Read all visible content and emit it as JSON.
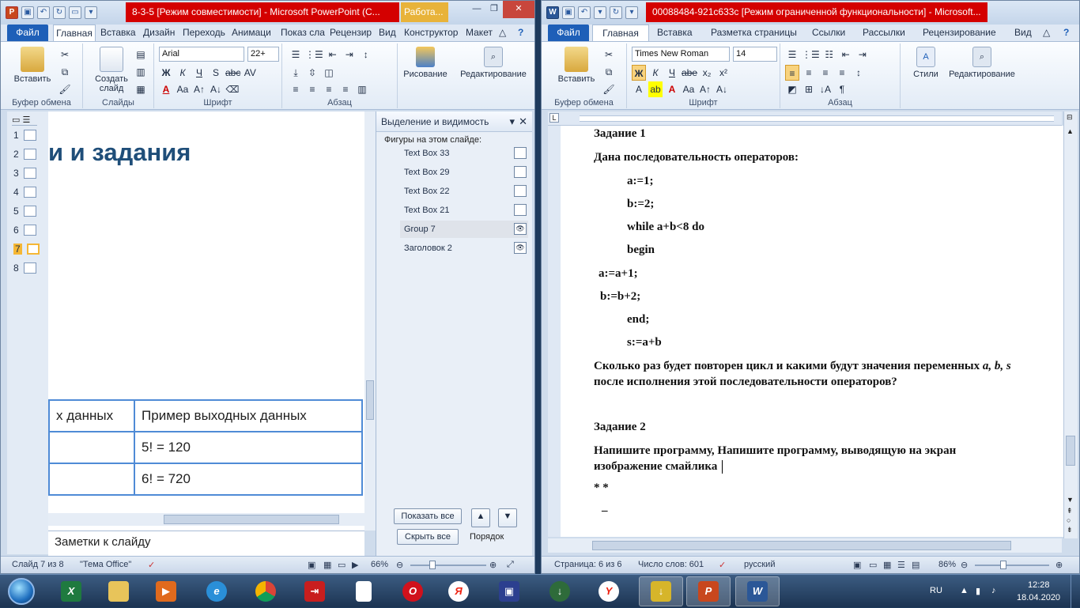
{
  "ppt": {
    "title": "8-3-5 [Режим совместимости] - Microsoft PowerPoint (С...",
    "context_tab": "Работа...",
    "tabs": {
      "file": "Файл",
      "home": "Главная",
      "insert": "Вставка",
      "design": "Дизайн",
      "transitions": "Переходь",
      "animations": "Анимаци",
      "slideshow": "Показ сла",
      "review": "Рецензир",
      "view": "Вид",
      "constructor": "Конструктор",
      "layout": "Макет"
    },
    "ribbon": {
      "paste": "Вставить",
      "new_slide": "Создать слайд",
      "font_name": "Arial",
      "font_size": "22+",
      "drawing": "Рисование",
      "editing": "Редактирование",
      "groups": {
        "clipboard": "Буфер обмена",
        "slides": "Слайды",
        "font": "Шрифт",
        "paragraph": "Абзац"
      }
    },
    "slides": [
      "1",
      "2",
      "3",
      "4",
      "5",
      "6",
      "7",
      "8"
    ],
    "slide": {
      "heading": "и и задания",
      "table": [
        [
          "х данных",
          "Пример  выходных данных"
        ],
        [
          "",
          "5! = 120"
        ],
        [
          "",
          "6! = 720"
        ]
      ]
    },
    "notes": "Заметки к слайду",
    "selection_pane": {
      "title": "Выделение и видимость",
      "subtitle": "Фигуры на этом слайде:",
      "items": [
        "Text Box 33",
        "Text Box 29",
        "Text Box 22",
        "Text Box 21",
        "Group 7",
        "Заголовок 2"
      ],
      "show_all": "Показать все",
      "hide_all": "Скрыть все",
      "order": "Порядок"
    },
    "status": {
      "slide": "Слайд 7 из 8",
      "theme": "\"Тема Office\"",
      "zoom": "66%"
    }
  },
  "word": {
    "title": "00088484-921c633c [Режим ограниченной функциональности] - Microsoft...",
    "tabs": {
      "file": "Файл",
      "home": "Главная",
      "insert": "Вставка",
      "page_layout": "Разметка страницы",
      "links": "Ссылки",
      "mailings": "Рассылки",
      "review": "Рецензирование",
      "view": "Вид"
    },
    "ribbon": {
      "paste": "Вставить",
      "font_name": "Times New Roman",
      "font_size": "14",
      "styles": "Стили",
      "editing": "Редактирование",
      "groups": {
        "clipboard": "Буфер обмена",
        "font": "Шрифт",
        "paragraph": "Абзац"
      }
    },
    "doc": {
      "task1": "Задание 1",
      "given": "Дана последовательность операторов:",
      "code": [
        "a:=1;",
        "b:=2;",
        "while a+b<8 do",
        "begin",
        " a:=a+1;",
        "b:=b+2;",
        "end;",
        "s:=a+b"
      ],
      "question1": "Сколько раз будет повторен цикл и какими будут  значения  переменных",
      "vars": "a, b, s",
      "question2": "после исполнения этой последовательности операторов?",
      "task2": "Задание 2",
      "prompt1": "Напишите программу, Напишите программу, выводящую на экран",
      "prompt2": "изображение  смайлика",
      "smile1": "*    *",
      "smile2": "_"
    },
    "status": {
      "page": "Страница: 6 из 6",
      "words": "Число слов: 601",
      "lang": "русский",
      "zoom": "86%"
    }
  },
  "taskbar": {
    "lang": "RU",
    "time": "12:28",
    "date": "18.04.2020"
  }
}
